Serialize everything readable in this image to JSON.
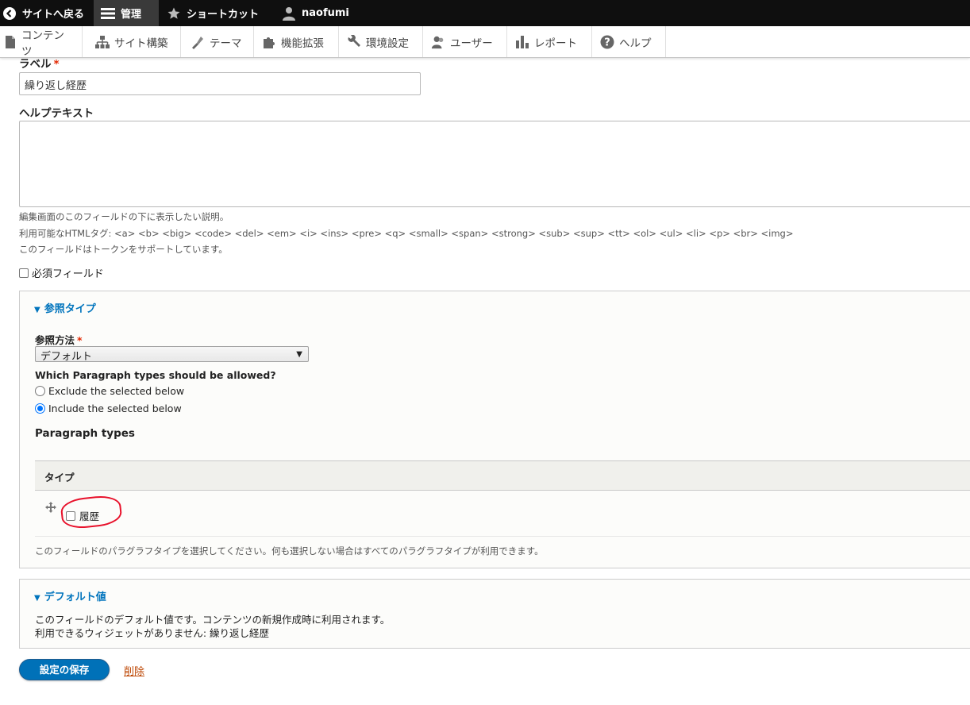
{
  "toolbar": {
    "back_label": "サイトへ戻る",
    "manage_label": "管理",
    "shortcuts_label": "ショートカット",
    "user_label": "naofumi"
  },
  "tray": {
    "items": [
      {
        "label": "コンテンツ",
        "icon": "page-icon"
      },
      {
        "label": "サイト構築",
        "icon": "sitemap-icon"
      },
      {
        "label": "テーマ",
        "icon": "brush-icon"
      },
      {
        "label": "機能拡張",
        "icon": "puzzle-icon"
      },
      {
        "label": "環境設定",
        "icon": "wrench-icon"
      },
      {
        "label": "ユーザー",
        "icon": "people-icon"
      },
      {
        "label": "レポート",
        "icon": "bar-chart-icon"
      },
      {
        "label": "ヘルプ",
        "icon": "question-icon"
      }
    ]
  },
  "form": {
    "label_title": "ラベル",
    "required_mark": "*",
    "label_value": "繰り返し経歴",
    "help_title": "ヘルプテキスト",
    "help_value": "",
    "help_desc_1": "編集画面のこのフィールドの下に表示したい説明。",
    "help_desc_2": "利用可能なHTMLタグ: <a> <b> <big> <code> <del> <em> <i> <ins> <pre> <q> <small> <span> <strong> <sub> <sup> <tt> <ol> <ul> <li> <p> <br> <img>",
    "help_desc_3": "このフィールドはトークンをサポートしています。",
    "required_field_label": "必須フィールド"
  },
  "reference": {
    "legend": "参照タイプ",
    "method_label": "参照方法",
    "method_value": "デフォルト",
    "allowed_question": "Which Paragraph types should be allowed?",
    "option_exclude": "Exclude the selected below",
    "option_include": "Include the selected below",
    "selected_option": "include",
    "ptypes_title": "Paragraph types",
    "table_header": "タイプ",
    "rows": [
      {
        "label": "履歴",
        "checked": false
      }
    ],
    "ptypes_desc": "このフィールドのパラグラフタイプを選択してください。何も選択しない場合はすべてのパラグラフタイプが利用できます。"
  },
  "default_value": {
    "legend": "デフォルト値",
    "line1": "このフィールドのデフォルト値です。コンテンツの新規作成時に利用されます。",
    "line2": "利用できるウィジェットがありません: 繰り返し経歴"
  },
  "actions": {
    "save_label": "設定の保存",
    "delete_label": "削除"
  },
  "colors": {
    "accent": "#0074bd",
    "annotation": "#e8102a",
    "required": "#e32700"
  }
}
